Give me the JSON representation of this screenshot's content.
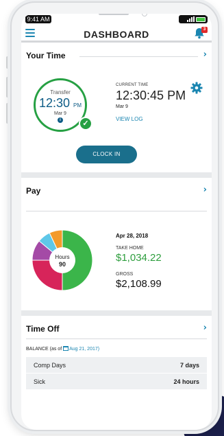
{
  "status": {
    "time": "9:41 AM"
  },
  "header": {
    "title": "DASHBOARD",
    "notification_count": "3"
  },
  "your_time": {
    "title": "Your Time",
    "ring_label": "Transfer",
    "ring_time": "12:30",
    "ring_ampm": "PM",
    "ring_date": "Mar 9",
    "current_label": "CURRENT TIME",
    "current_time": "12:30:45 PM",
    "current_date": "Mar 9",
    "view_log": "VIEW LOG",
    "clock_in": "CLOCK IN"
  },
  "pay": {
    "title": "Pay",
    "date": "Apr 28, 2018",
    "take_home_label": "TAKE HOME",
    "take_home": "$1,034.22",
    "gross_label": "GROSS",
    "gross": "$2,108.99",
    "donut_center_label": "Hours",
    "donut_center_value": "90",
    "segments": [
      {
        "color": "#3bb54a",
        "fraction": 0.5
      },
      {
        "color": "#d7245a",
        "fraction": 0.25
      },
      {
        "color": "#a44aa6",
        "fraction": 0.11
      },
      {
        "color": "#5ec7e8",
        "fraction": 0.07
      },
      {
        "color": "#f39a2b",
        "fraction": 0.07
      }
    ]
  },
  "time_off": {
    "title": "Time Off",
    "balance_label": "BALANCE",
    "as_of": "(as of",
    "as_of_date": "Aug 21, 2017)",
    "rows": [
      {
        "name": "Comp Days",
        "value": "7 days"
      },
      {
        "name": "Sick",
        "value": "24 hours"
      }
    ]
  },
  "colors": {
    "accent": "#1b86b1",
    "success": "#26a043",
    "clock_in_bg": "#1a6f8c"
  }
}
